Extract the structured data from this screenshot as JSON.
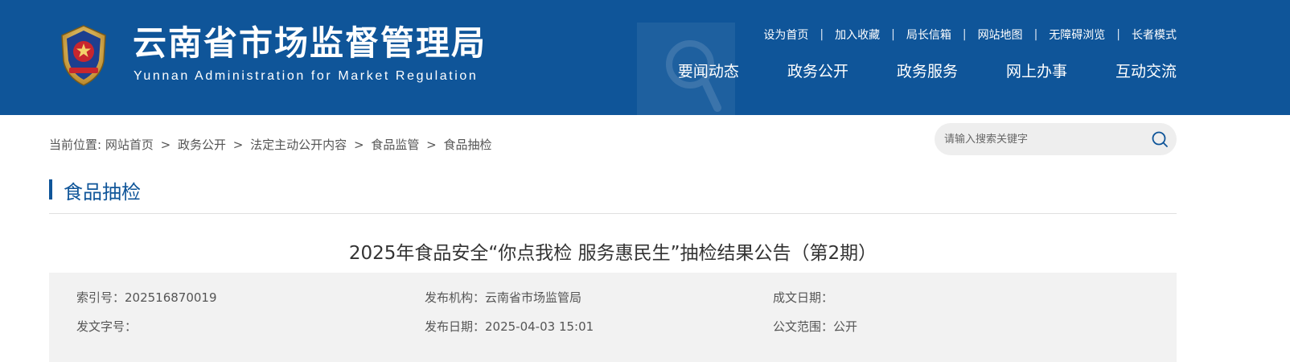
{
  "header": {
    "title": "云南省市场监督管理局",
    "subtitle": "Yunnan Administration for Market Regulation",
    "toplinks": [
      "设为首页",
      "加入收藏",
      "局长信箱",
      "网站地图",
      "无障碍浏览",
      "长者模式"
    ],
    "separator": "|",
    "nav": [
      "要闻动态",
      "政务公开",
      "政务服务",
      "网上办事",
      "互动交流"
    ]
  },
  "breadcrumb": {
    "prefix": "当前位置:",
    "items": [
      "网站首页",
      "政务公开",
      "法定主动公开内容",
      "食品监管",
      "食品抽检"
    ],
    "arrow": ">"
  },
  "search": {
    "placeholder": "请输入搜索关键字",
    "icon": "search-icon"
  },
  "section": {
    "title": "食品抽检"
  },
  "article": {
    "title": "2025年食品安全“你点我检 服务惠民生”抽检结果公告（第2期）"
  },
  "meta": {
    "index_label": "索引号：202516870019",
    "publisher_label": "发布机构：云南省市场监管局",
    "written_date_label": "成文日期：",
    "doc_number_label": "发文字号：",
    "publish_date_label": "发布日期：2025-04-03 15:01",
    "scope_label": "公文范围：公开"
  },
  "colors": {
    "header_bg": "#0f5599",
    "accent": "#0f5599",
    "meta_bg": "#f2f2f2"
  }
}
